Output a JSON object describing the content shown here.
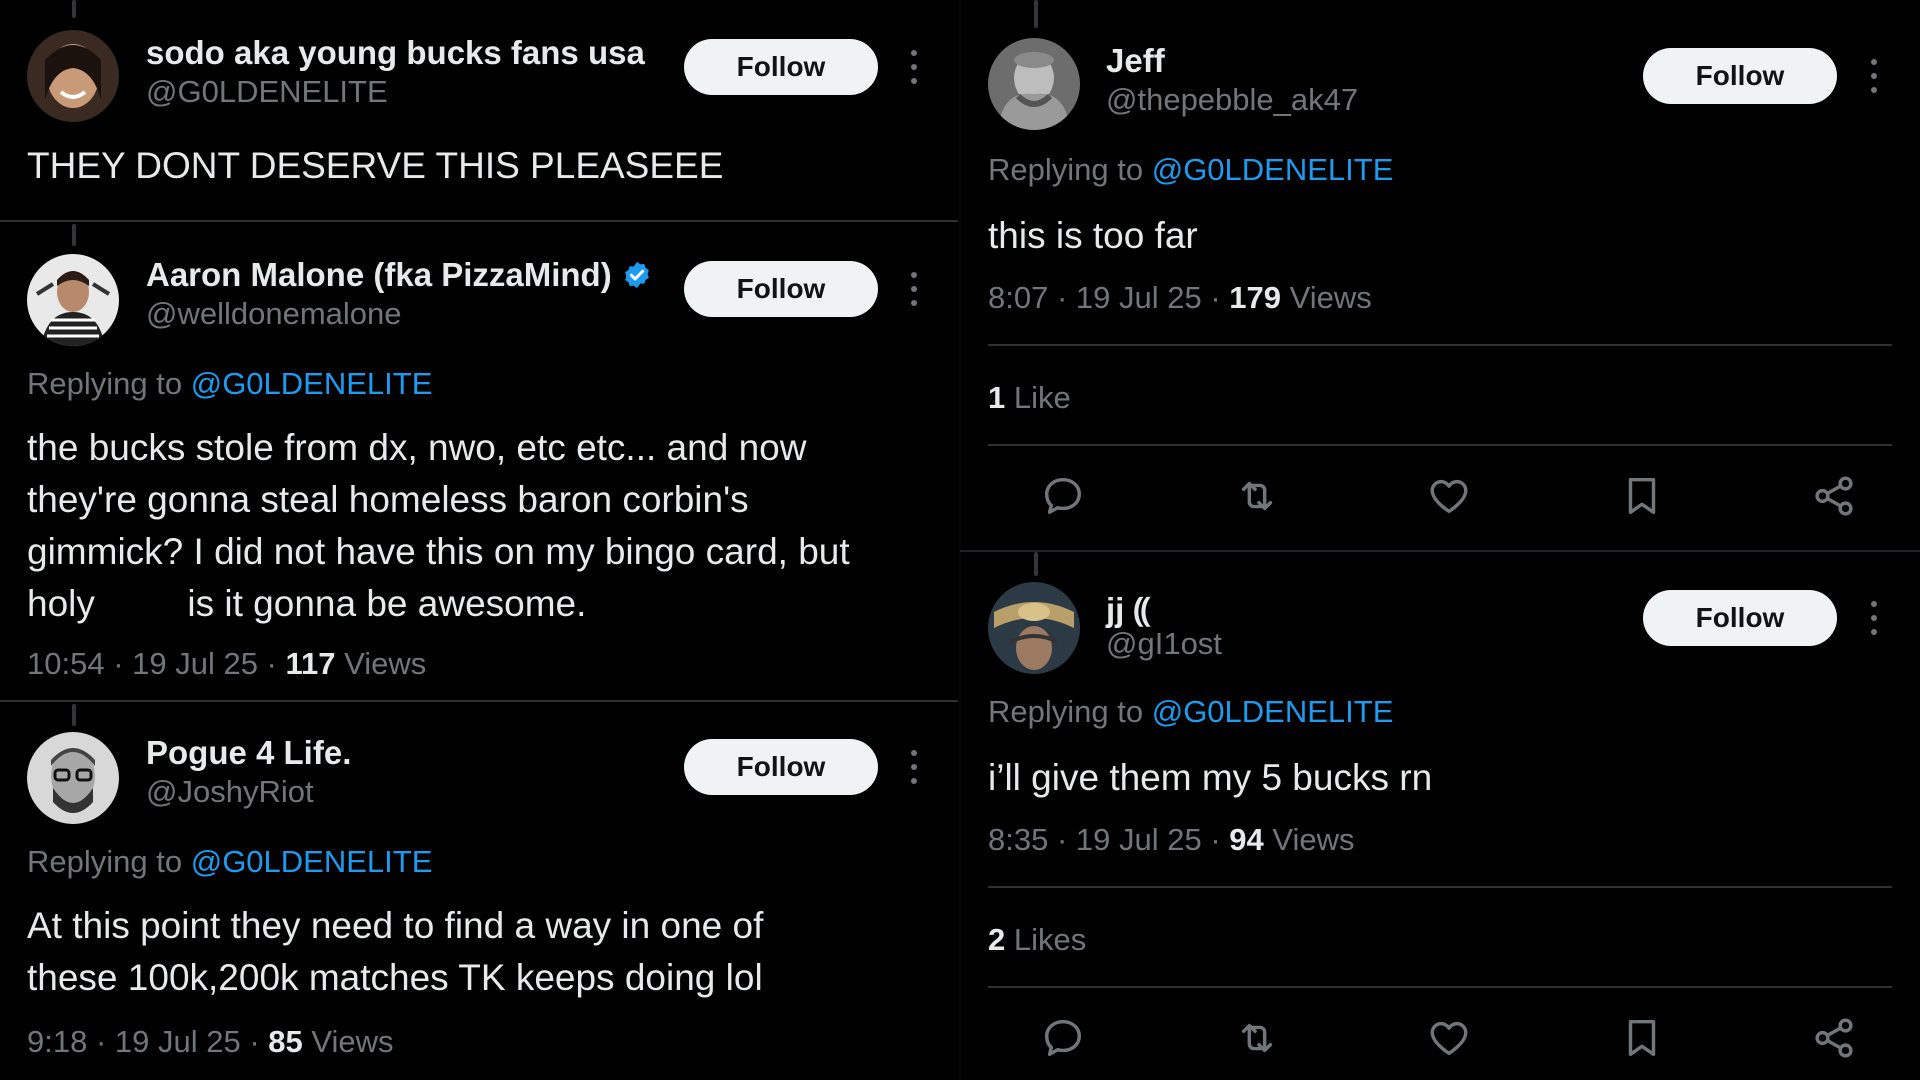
{
  "tweets_left": [
    {
      "name": "sodo aka young bucks fans usa",
      "handle": "@G0LDENELITE",
      "follow_label": "Follow",
      "text": "THEY DONT DESERVE THIS PLEASEEE"
    },
    {
      "name": "Aaron Malone (fka PizzaMind)",
      "handle": "@welldonemalone",
      "follow_label": "Follow",
      "replying_prefix": "Replying to ",
      "replying_to": "@G0LDENELITE",
      "text_lines": [
        "the bucks stole from dx, nwo, etc etc... and now",
        "they're gonna steal homeless baron corbin's",
        "gimmick? I did not have this on my bingo card, but",
        "holy         is it gonna be awesome."
      ],
      "time": "10:54 · 19 Jul 25 · ",
      "views": "117",
      "views_label": " Views"
    },
    {
      "name": "Pogue 4 Life.",
      "handle": "@JoshyRiot",
      "follow_label": "Follow",
      "replying_prefix": "Replying to ",
      "replying_to": "@G0LDENELITE",
      "text_lines": [
        "At this point they need to find a way in one of",
        "these 100k,200k matches TK keeps doing lol"
      ],
      "time": "9:18 · 19 Jul 25 · ",
      "views": "85",
      "views_label": " Views"
    }
  ],
  "tweets_right": [
    {
      "name": "Jeff",
      "handle": "@thepebble_ak47",
      "follow_label": "Follow",
      "replying_prefix": "Replying to ",
      "replying_to": "@G0LDENELITE",
      "text": "this is too far",
      "time": "8:07 · 19 Jul 25 · ",
      "views": "179",
      "views_label": " Views",
      "likes_count": "1",
      "likes_label": " Like"
    },
    {
      "name": "jj ⸨",
      "handle": "@gI1ost",
      "follow_label": "Follow",
      "replying_prefix": "Replying to ",
      "replying_to": "@G0LDENELITE",
      "text": "i’ll give them my 5 bucks rn",
      "time": "8:35 · 19 Jul 25 · ",
      "views": "94",
      "views_label": " Views",
      "likes_count": "2",
      "likes_label": " Likes"
    }
  ],
  "icons": [
    "reply-icon",
    "retweet-icon",
    "like-icon",
    "bookmark-icon",
    "share-icon"
  ],
  "colors": {
    "background": "#000000",
    "text": "#e7e9ea",
    "muted": "#71767b",
    "link": "#1d9bf0",
    "verified": "#1d9bf0",
    "button_bg": "#eff3f4",
    "divider": "#2f3336"
  }
}
